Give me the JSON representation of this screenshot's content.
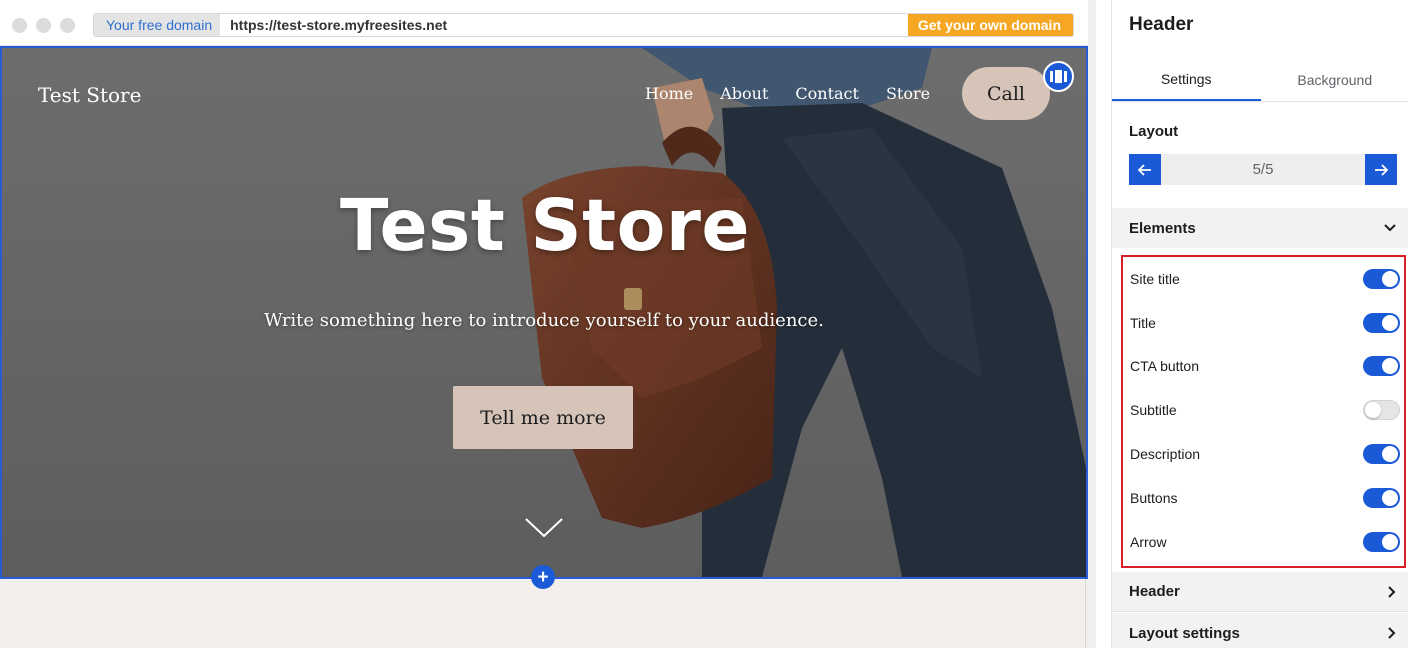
{
  "browser": {
    "free_domain_label": "Your free domain",
    "url": "https://test-store.myfreesites.net",
    "get_domain_label": "Get your own domain"
  },
  "site": {
    "logo_text": "Test Store",
    "nav": [
      "Home",
      "About",
      "Contact",
      "Store"
    ],
    "call_button": "Call",
    "hero_title": "Test Store",
    "hero_description": "Write something here to introduce yourself to your audience.",
    "cta_button": "Tell me more",
    "arrow_icon": "chevron-down-icon"
  },
  "editor": {
    "title": "Header",
    "tabs": [
      {
        "label": "Settings",
        "active": true
      },
      {
        "label": "Background",
        "active": false
      }
    ],
    "layout": {
      "label": "Layout",
      "value": "5/5"
    },
    "elements_section": {
      "label": "Elements",
      "expanded": true
    },
    "elements": [
      {
        "label": "Site title",
        "enabled": true
      },
      {
        "label": "Title",
        "enabled": true
      },
      {
        "label": "CTA button",
        "enabled": true
      },
      {
        "label": "Subtitle",
        "enabled": false
      },
      {
        "label": "Description",
        "enabled": true
      },
      {
        "label": "Buttons",
        "enabled": true
      },
      {
        "label": "Arrow",
        "enabled": true
      }
    ],
    "collapsed_sections": [
      "Header",
      "Layout settings"
    ]
  },
  "colors": {
    "accent": "#1a5ad7",
    "highlight_border": "#d81f26",
    "cta_background": "#d6c4b8",
    "domain_button": "#f5a623"
  }
}
